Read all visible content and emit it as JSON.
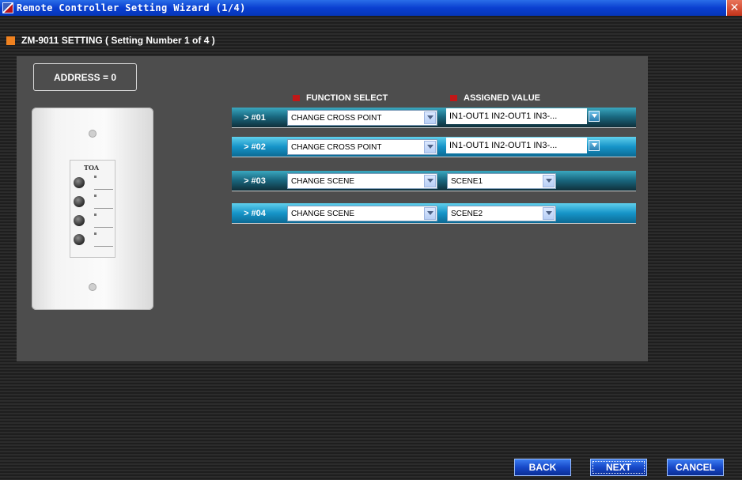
{
  "window": {
    "title": "Remote Controller Setting Wizard (1/4)",
    "close_glyph": "✕",
    "app_icon": "toa-app-icon"
  },
  "header": {
    "text": "ZM-9011 SETTING   ( Setting Number 1 of 4 )"
  },
  "panel": {
    "address": "ADDRESS = 0",
    "device_logo": "TOA",
    "columns": {
      "function_select": "FUNCTION SELECT",
      "assigned_value": "ASSIGNED VALUE"
    },
    "rows": [
      {
        "label": "> #01",
        "function": "CHANGE CROSS POINT",
        "assigned": "IN1-OUT1 IN2-OUT1 IN3-..."
      },
      {
        "label": "> #02",
        "function": "CHANGE CROSS POINT",
        "assigned": "IN1-OUT1 IN2-OUT1 IN3-..."
      },
      {
        "label": "> #03",
        "function": "CHANGE SCENE",
        "assigned": "SCENE1"
      },
      {
        "label": "> #04",
        "function": "CHANGE SCENE",
        "assigned": "SCENE2"
      }
    ]
  },
  "footer": {
    "back": "BACK",
    "next": "NEXT",
    "cancel": "CANCEL"
  },
  "colors": {
    "title_blue": "#0a3fd0",
    "header_marker": "#f08220",
    "column_marker": "#c01818",
    "row_light": "#1694c8",
    "row_dark": "#0f2f3a",
    "button_blue": "#1748c8"
  }
}
